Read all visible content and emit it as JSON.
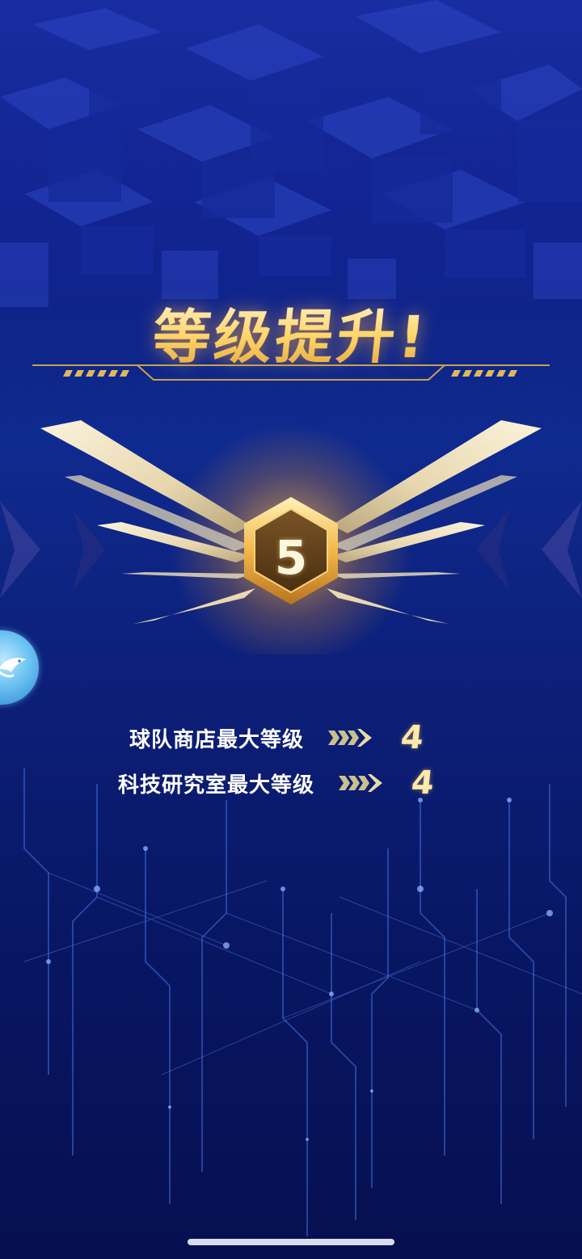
{
  "popup": {
    "title": "等级提升!",
    "level": "5"
  },
  "rewards": [
    {
      "label": "球队商店最大等级",
      "value": "4"
    },
    {
      "label": "科技研究室最大等级",
      "value": "4"
    }
  ],
  "colors": {
    "gold": "#ffd66a",
    "background": "#0c2080",
    "badge": "#6b4a1f"
  },
  "icons": {
    "float_button": "fish-logo-icon",
    "arrow": "triple-chevron-arrow-icon",
    "emblem": "winged-hexagon-badge-icon"
  }
}
